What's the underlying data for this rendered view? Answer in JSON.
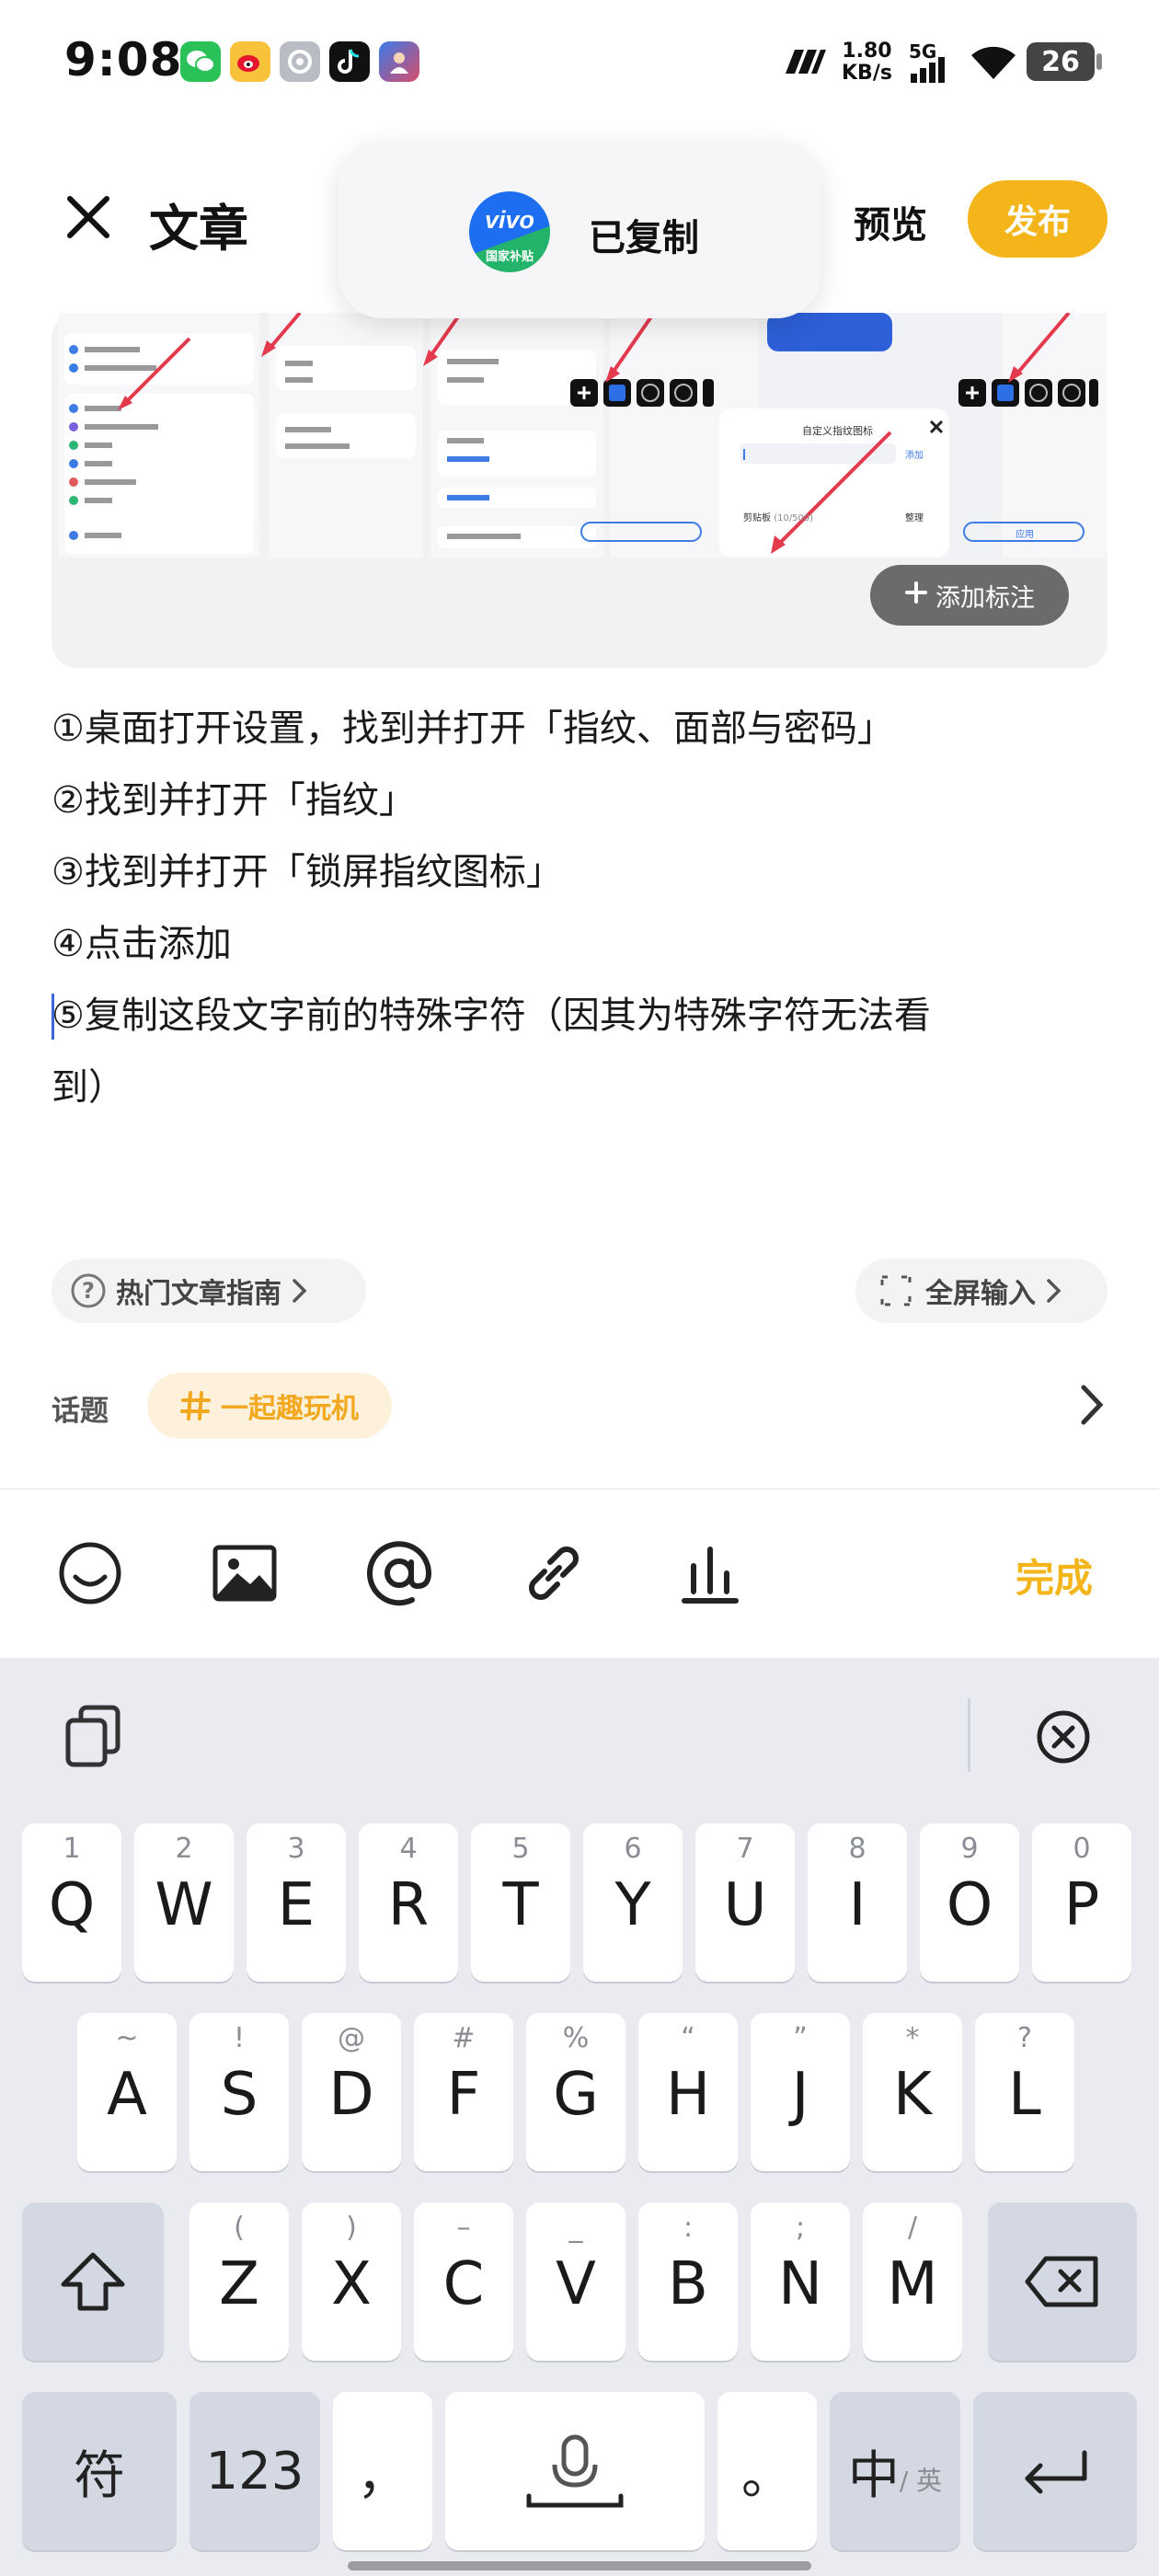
{
  "status_bar": {
    "time": "9:08",
    "net_speed_value": "1.80",
    "net_speed_unit": "KB/s",
    "signal_label": "5G",
    "battery": "26",
    "app_icons": [
      "wechat-icon",
      "weibo-icon",
      "settings-app-icon",
      "tiktok-icon",
      "game-app-icon"
    ]
  },
  "header": {
    "title": "文章",
    "preview_label": "预览",
    "publish_label": "发布"
  },
  "toast": {
    "logo_text": "vivo",
    "logo_subtext": "国家补贴",
    "message": "已复制"
  },
  "image_card": {
    "add_note_label": "添加标注",
    "screenshot_labels": {
      "dialog_title": "自定义指纹图标",
      "dialog_action": "添加",
      "clipboard_label": "剪贴板",
      "clipboard_count": "(10/500)",
      "manage_label": "整理",
      "confirm_label": "应用"
    }
  },
  "article": {
    "lines": [
      "①桌面打开设置，找到并打开「指纹、面部与密码」",
      "②找到并打开「指纹」",
      "③找到并打开「锁屏指纹图标」",
      "④点击添加",
      "⑤复制这段文字前的特殊字符（因其为特殊字符无法看",
      "到）"
    ]
  },
  "chips": {
    "hot_guide": "热门文章指南",
    "fullscreen_input": "全屏输入",
    "topic_label": "话题",
    "topic_name": "一起趣玩机"
  },
  "toolbar": {
    "done_label": "完成"
  },
  "keyboard": {
    "row1": [
      {
        "hint": "1",
        "key": "Q"
      },
      {
        "hint": "2",
        "key": "W"
      },
      {
        "hint": "3",
        "key": "E"
      },
      {
        "hint": "4",
        "key": "R"
      },
      {
        "hint": "5",
        "key": "T"
      },
      {
        "hint": "6",
        "key": "Y"
      },
      {
        "hint": "7",
        "key": "U"
      },
      {
        "hint": "8",
        "key": "I"
      },
      {
        "hint": "9",
        "key": "O"
      },
      {
        "hint": "0",
        "key": "P"
      }
    ],
    "row2": [
      {
        "hint": "~",
        "key": "A"
      },
      {
        "hint": "!",
        "key": "S"
      },
      {
        "hint": "@",
        "key": "D"
      },
      {
        "hint": "#",
        "key": "F"
      },
      {
        "hint": "%",
        "key": "G"
      },
      {
        "hint": "“",
        "key": "H"
      },
      {
        "hint": "”",
        "key": "J"
      },
      {
        "hint": "*",
        "key": "K"
      },
      {
        "hint": "?",
        "key": "L"
      }
    ],
    "row3": [
      {
        "hint": "(",
        "key": "Z"
      },
      {
        "hint": ")",
        "key": "X"
      },
      {
        "hint": "–",
        "key": "C"
      },
      {
        "hint": "_",
        "key": "V"
      },
      {
        "hint": ":",
        "key": "B"
      },
      {
        "hint": ";",
        "key": "N"
      },
      {
        "hint": "/",
        "key": "M"
      }
    ],
    "symbols_label": "符",
    "numbers_label": "123",
    "comma_label": "，",
    "period_label": "。",
    "lang_main": "中",
    "lang_alt": "/ 英"
  }
}
